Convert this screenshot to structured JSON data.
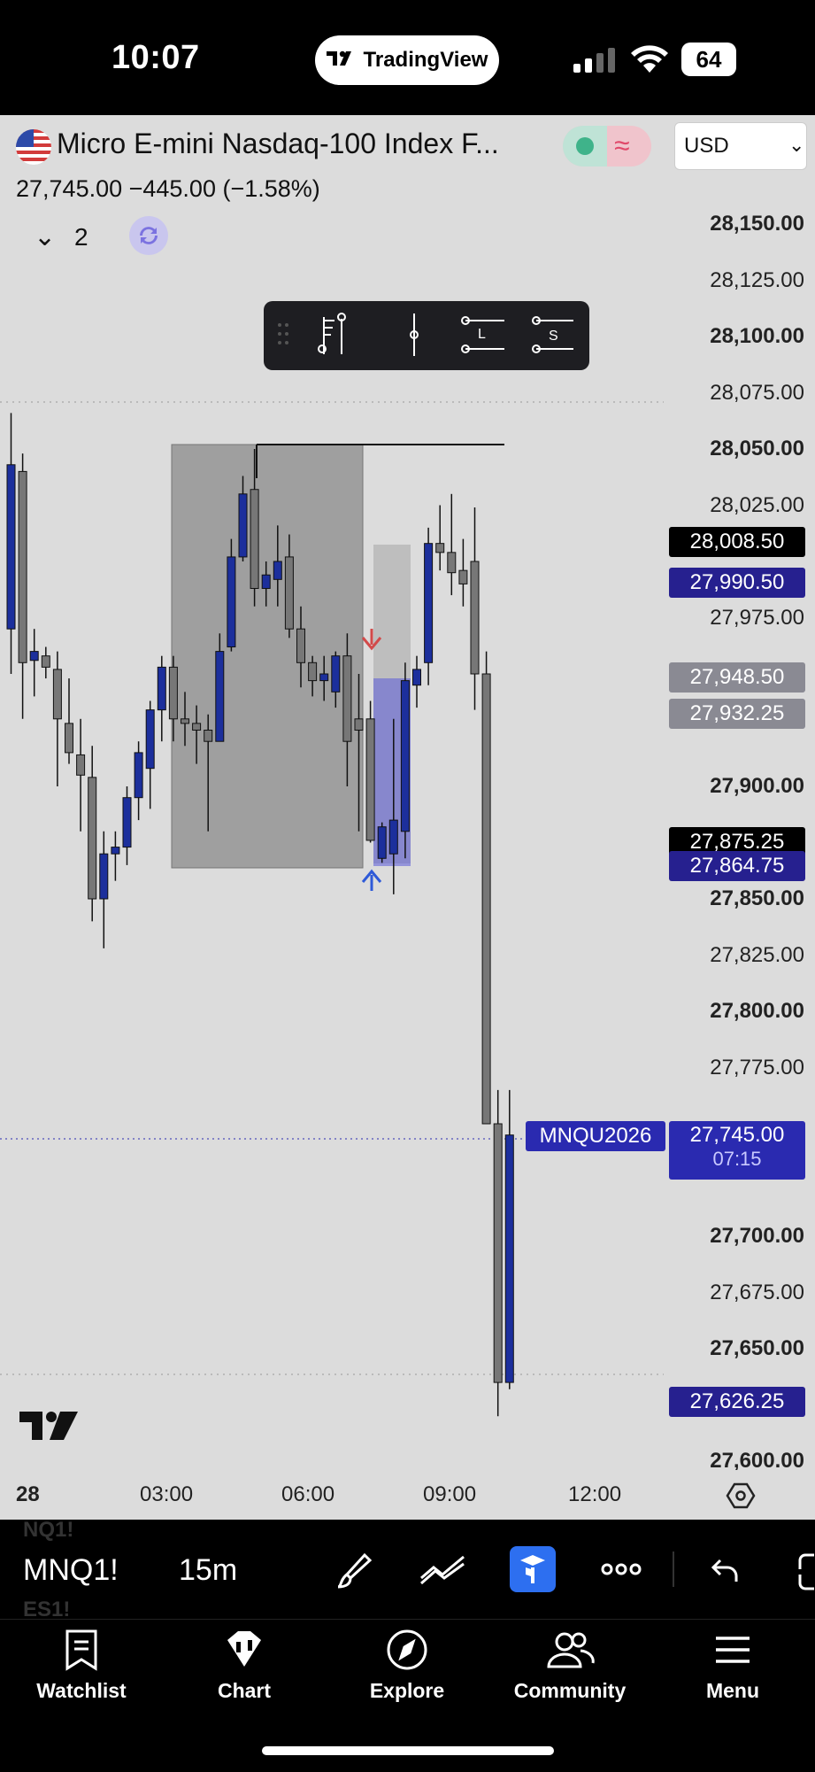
{
  "status_bar": {
    "time": "10:07",
    "app_badge": "TradingView",
    "battery": "64"
  },
  "header": {
    "symbol_title": "Micro E-mini Nasdaq-100 Index F...",
    "price_line": "27,745.00  −445.00 (−1.58%)",
    "currency": "USD",
    "layers_count": "2"
  },
  "price_axis": {
    "labels": [
      {
        "text": "28,150.00",
        "bold": true
      },
      {
        "text": "28,125.00",
        "bold": false
      },
      {
        "text": "28,100.00",
        "bold": true
      },
      {
        "text": "28,075.00",
        "bold": false
      },
      {
        "text": "28,050.00",
        "bold": true
      },
      {
        "text": "28,025.00",
        "bold": false
      },
      {
        "text": "27,975.00",
        "bold": false
      },
      {
        "text": "27,900.00",
        "bold": true
      },
      {
        "text": "27,850.00",
        "bold": true
      },
      {
        "text": "27,825.00",
        "bold": false
      },
      {
        "text": "27,800.00",
        "bold": true
      },
      {
        "text": "27,775.00",
        "bold": false
      },
      {
        "text": "27,700.00",
        "bold": true
      },
      {
        "text": "27,675.00",
        "bold": false
      },
      {
        "text": "27,650.00",
        "bold": true
      },
      {
        "text": "27,600.00",
        "bold": true
      }
    ],
    "badges": {
      "b1": "28,008.50",
      "b2": "27,990.50",
      "b3": "27,948.50",
      "b4": "27,932.25",
      "b5": "27,875.25",
      "b6": "27,864.75",
      "b7": "27,626.25",
      "current_price": "27,745.00",
      "countdown": "07:15",
      "symbol_tag": "MNQU2026"
    }
  },
  "time_axis": {
    "labels": [
      "28",
      "03:00",
      "06:00",
      "09:00",
      "12:00"
    ]
  },
  "toolbar": {
    "symbol": "MNQ1!",
    "interval": "15m",
    "ghost_above": "NQ1!",
    "ghost_below": "ES1!"
  },
  "tabs": [
    "Watchlist",
    "Chart",
    "Explore",
    "Community",
    "Menu"
  ],
  "colors": {
    "bull": "#1c2f9c",
    "bear": "#777777",
    "badge_blue": "#26208f",
    "badge_gray": "#8a8a93",
    "badge_black": "#000000",
    "price_tag": "#2a2ab0"
  },
  "chart_data": {
    "type": "candlestick",
    "interval": "15m",
    "x_ticks": [
      "28",
      "03:00",
      "06:00",
      "09:00",
      "12:00"
    ],
    "ylim": [
      27600,
      28160
    ],
    "candles": [
      [
        27970,
        28066,
        27950,
        28043
      ],
      [
        28040,
        28048,
        27930,
        27955
      ],
      [
        27956,
        27970,
        27940,
        27960
      ],
      [
        27958,
        27962,
        27948,
        27953
      ],
      [
        27952,
        27960,
        27900,
        27930
      ],
      [
        27928,
        27948,
        27910,
        27915
      ],
      [
        27914,
        27930,
        27880,
        27905
      ],
      [
        27904,
        27918,
        27840,
        27850
      ],
      [
        27850,
        27880,
        27828,
        27870
      ],
      [
        27870,
        27880,
        27858,
        27873
      ],
      [
        27873,
        27900,
        27865,
        27895
      ],
      [
        27895,
        27920,
        27885,
        27915
      ],
      [
        27908,
        27938,
        27890,
        27934
      ],
      [
        27934,
        27958,
        27920,
        27953
      ],
      [
        27953,
        27958,
        27920,
        27930
      ],
      [
        27930,
        27942,
        27918,
        27928
      ],
      [
        27928,
        27936,
        27910,
        27925
      ],
      [
        27925,
        27932,
        27880,
        27920
      ],
      [
        27920,
        27968,
        27920,
        27960
      ],
      [
        27962,
        28010,
        27960,
        28002
      ],
      [
        28002,
        28038,
        28000,
        28030
      ],
      [
        28032,
        28050,
        27980,
        27988
      ],
      [
        27988,
        28000,
        27980,
        27994
      ],
      [
        27992,
        28016,
        27980,
        28000
      ],
      [
        28002,
        28012,
        27966,
        27970
      ],
      [
        27970,
        27980,
        27944,
        27955
      ],
      [
        27955,
        27958,
        27940,
        27947
      ],
      [
        27947,
        27958,
        27938,
        27950
      ],
      [
        27942,
        27960,
        27935,
        27958
      ],
      [
        27958,
        27968,
        27900,
        27920
      ],
      [
        27930,
        27950,
        27880,
        27925
      ],
      [
        27930,
        27938,
        27875,
        27876
      ],
      [
        27868,
        27884,
        27866,
        27882
      ],
      [
        27870,
        27930,
        27852,
        27885
      ],
      [
        27880,
        27955,
        27868,
        27947
      ],
      [
        27945,
        27958,
        27935,
        27952
      ],
      [
        27955,
        28015,
        27945,
        28008
      ],
      [
        28008,
        28025,
        27996,
        28004
      ],
      [
        28004,
        28030,
        27985,
        27995
      ],
      [
        27996,
        28010,
        27980,
        27990
      ],
      [
        28000,
        28024,
        27934,
        27950
      ],
      [
        27950,
        27960,
        27750,
        27750
      ],
      [
        27750,
        27765,
        27620,
        27635
      ],
      [
        27635,
        27765,
        27632,
        27745
      ]
    ]
  }
}
